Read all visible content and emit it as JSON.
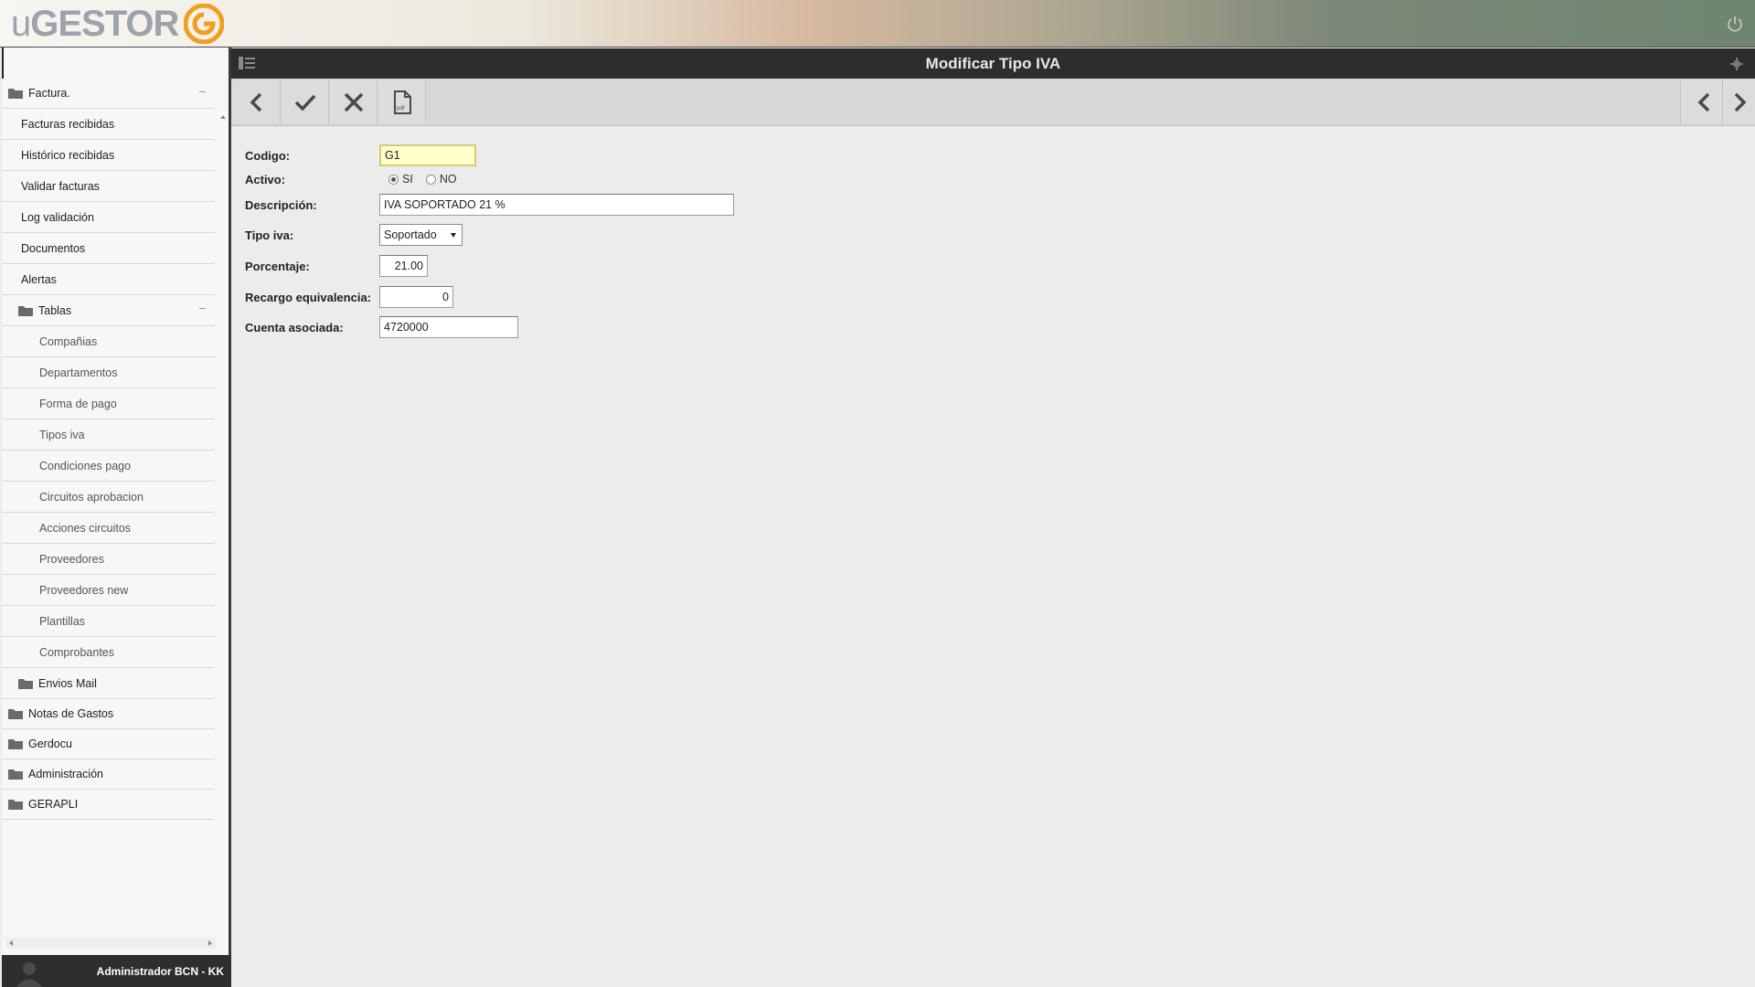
{
  "app": {
    "logo_prefix": "u",
    "logo_main": "GESTOR"
  },
  "page": {
    "title": "Modificar Tipo IVA"
  },
  "sidebar": {
    "items": [
      {
        "label": "Factura.",
        "level": 0,
        "folder": true,
        "expanded": true
      },
      {
        "label": "Facturas recibidas",
        "level": 1
      },
      {
        "label": "Histórico recibidas",
        "level": 1
      },
      {
        "label": "Validar facturas",
        "level": 1
      },
      {
        "label": "Log validación",
        "level": 1
      },
      {
        "label": "Documentos",
        "level": 1
      },
      {
        "label": "Alertas",
        "level": 1
      },
      {
        "label": "Tablas",
        "level": 1,
        "folder": true,
        "expanded": true
      },
      {
        "label": "Compañias",
        "level": 2
      },
      {
        "label": "Departamentos",
        "level": 2
      },
      {
        "label": "Forma de pago",
        "level": 2
      },
      {
        "label": "Tipos iva",
        "level": 2
      },
      {
        "label": "Condiciones pago",
        "level": 2
      },
      {
        "label": "Circuitos aprobacion",
        "level": 2
      },
      {
        "label": "Acciones circuitos",
        "level": 2
      },
      {
        "label": "Proveedores",
        "level": 2
      },
      {
        "label": "Proveedores new",
        "level": 2
      },
      {
        "label": "Plantillas",
        "level": 2
      },
      {
        "label": "Comprobantes",
        "level": 2
      },
      {
        "label": "Envios Mail",
        "level": 1,
        "folder": true
      },
      {
        "label": "Notas de Gastos",
        "level": 0,
        "folder": true
      },
      {
        "label": "Gerdocu",
        "level": 0,
        "folder": true
      },
      {
        "label": "Administración",
        "level": 0,
        "folder": true
      },
      {
        "label": "GERAPLI",
        "level": 0,
        "folder": true
      }
    ]
  },
  "user": {
    "name": "Administrador BCN - KK"
  },
  "toolbar": {
    "buttons": [
      {
        "name": "back-button",
        "icon": "chevron-left-icon"
      },
      {
        "name": "accept-button",
        "icon": "check-icon"
      },
      {
        "name": "cancel-button",
        "icon": "close-icon"
      },
      {
        "name": "pdf-button",
        "icon": "pdf-icon",
        "icon_text": "pdf"
      }
    ]
  },
  "form": {
    "codigo": {
      "label": "Codigo:",
      "value": "G1"
    },
    "activo": {
      "label": "Activo:",
      "options": [
        "SI",
        "NO"
      ],
      "selected": "SI"
    },
    "descripcion": {
      "label": "Descripción:",
      "value": "IVA SOPORTADO 21 %"
    },
    "tipo_iva": {
      "label": "Tipo iva:",
      "value": "Soportado"
    },
    "porcentaje": {
      "label": "Porcentaje:",
      "value": "21.00"
    },
    "recargo": {
      "label": "Recargo equivalencia:",
      "value": "0"
    },
    "cuenta": {
      "label": "Cuenta asociada:",
      "value": "4720000"
    }
  },
  "colors": {
    "logo_orange": "#f0a01e",
    "header_dark": "#2d2d2d",
    "highlight_field": "#ffffcc"
  }
}
